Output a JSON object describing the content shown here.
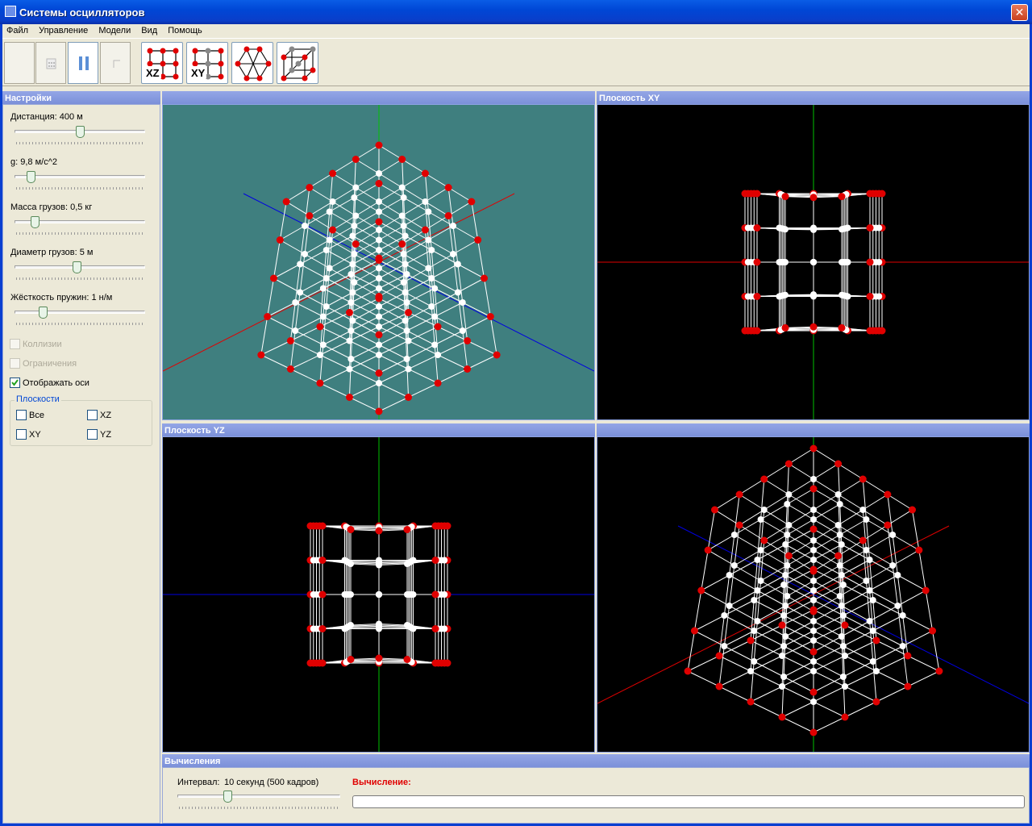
{
  "window": {
    "title": "Системы осцилляторов",
    "close_label": "✕"
  },
  "menu": [
    "Файл",
    "Управление",
    "Модели",
    "Вид",
    "Помощь"
  ],
  "toolbar": {
    "models": [
      "XZ",
      "XY",
      "",
      ""
    ]
  },
  "settings": {
    "title": "Настройки",
    "sliders": [
      {
        "label": "Дистанция: 400 м",
        "value": 0.5
      },
      {
        "label": "g: 9,8 м/с^2",
        "value": 0.1
      },
      {
        "label": "Масса грузов: 0,5 кг",
        "value": 0.13
      },
      {
        "label": "Диаметр грузов: 5 м",
        "value": 0.48
      },
      {
        "label": "Жёсткость пружин: 1 н/м",
        "value": 0.2
      }
    ],
    "checkboxes": [
      {
        "label": "Коллизии",
        "checked": false,
        "disabled": true
      },
      {
        "label": "Ограничения",
        "checked": false,
        "disabled": true
      },
      {
        "label": "Отображать оси",
        "checked": true,
        "disabled": false
      }
    ],
    "planes_group": {
      "title": "Плоскости",
      "items": [
        {
          "label": "Все",
          "checked": false
        },
        {
          "label": "XZ",
          "checked": false
        },
        {
          "label": "XY",
          "checked": false
        },
        {
          "label": "YZ",
          "checked": false
        }
      ]
    }
  },
  "viewports": {
    "top_left": {
      "title": "",
      "background": "#3f7f7f"
    },
    "top_right": {
      "title": "Плоскость XY",
      "background": "#000000"
    },
    "bottom_left": {
      "title": "Плоскость YZ",
      "background": "#000000"
    },
    "bottom_right": {
      "title": "",
      "background": "#000000"
    }
  },
  "calc": {
    "title": "Вычисления",
    "interval_label": "Интервал:",
    "interval_value": "10 секунд (500 кадров)",
    "slider_value": 0.3,
    "status_label": "Вычисление:",
    "progress": 0
  },
  "colors": {
    "node_red": "#e00000",
    "node_white": "#ffffff",
    "axis_x": "#e00000",
    "axis_y": "#00c000",
    "axis_z": "#0000e0"
  }
}
